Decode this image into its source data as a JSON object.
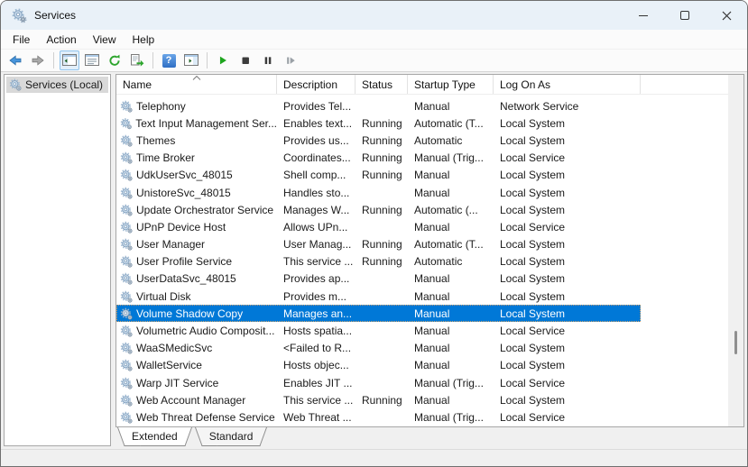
{
  "window": {
    "title": "Services",
    "controls": [
      {
        "name": "minimize",
        "icon": "minimize-icon"
      },
      {
        "name": "maximize",
        "icon": "maximize-icon"
      },
      {
        "name": "close",
        "icon": "close-icon"
      }
    ]
  },
  "menu": {
    "items": [
      "File",
      "Action",
      "View",
      "Help"
    ]
  },
  "toolbar": {
    "icons": [
      "back-arrow-icon",
      "forward-arrow-icon",
      "show-console-tree-icon",
      "properties-icon",
      "refresh-icon",
      "export-list-icon",
      "help-icon",
      "show-action-pane-icon",
      "start-service-icon",
      "stop-service-icon",
      "pause-service-icon",
      "restart-service-icon"
    ]
  },
  "sidebar": {
    "root_label": "Services (Local)"
  },
  "table": {
    "columns": [
      {
        "label": "Name"
      },
      {
        "label": "Description"
      },
      {
        "label": "Status"
      },
      {
        "label": "Startup Type"
      },
      {
        "label": "Log On As"
      }
    ],
    "sort": {
      "column": "Name",
      "direction": "ascending"
    },
    "rows": [
      {
        "name": "Telephony",
        "description": "Provides Tel...",
        "status": "",
        "startup_type": "Manual",
        "log_on_as": "Network Service",
        "selected": false
      },
      {
        "name": "Text Input Management Ser...",
        "description": "Enables text...",
        "status": "Running",
        "startup_type": "Automatic (T...",
        "log_on_as": "Local System",
        "selected": false
      },
      {
        "name": "Themes",
        "description": "Provides us...",
        "status": "Running",
        "startup_type": "Automatic",
        "log_on_as": "Local System",
        "selected": false
      },
      {
        "name": "Time Broker",
        "description": "Coordinates...",
        "status": "Running",
        "startup_type": "Manual (Trig...",
        "log_on_as": "Local Service",
        "selected": false
      },
      {
        "name": "UdkUserSvc_48015",
        "description": "Shell comp...",
        "status": "Running",
        "startup_type": "Manual",
        "log_on_as": "Local System",
        "selected": false
      },
      {
        "name": "UnistoreSvc_48015",
        "description": "Handles sto...",
        "status": "",
        "startup_type": "Manual",
        "log_on_as": "Local System",
        "selected": false
      },
      {
        "name": "Update Orchestrator Service",
        "description": "Manages W...",
        "status": "Running",
        "startup_type": "Automatic (...",
        "log_on_as": "Local System",
        "selected": false
      },
      {
        "name": "UPnP Device Host",
        "description": "Allows UPn...",
        "status": "",
        "startup_type": "Manual",
        "log_on_as": "Local Service",
        "selected": false
      },
      {
        "name": "User Manager",
        "description": "User Manag...",
        "status": "Running",
        "startup_type": "Automatic (T...",
        "log_on_as": "Local System",
        "selected": false
      },
      {
        "name": "User Profile Service",
        "description": "This service ...",
        "status": "Running",
        "startup_type": "Automatic",
        "log_on_as": "Local System",
        "selected": false
      },
      {
        "name": "UserDataSvc_48015",
        "description": "Provides ap...",
        "status": "",
        "startup_type": "Manual",
        "log_on_as": "Local System",
        "selected": false
      },
      {
        "name": "Virtual Disk",
        "description": "Provides m...",
        "status": "",
        "startup_type": "Manual",
        "log_on_as": "Local System",
        "selected": false
      },
      {
        "name": "Volume Shadow Copy",
        "description": "Manages an...",
        "status": "",
        "startup_type": "Manual",
        "log_on_as": "Local System",
        "selected": true
      },
      {
        "name": "Volumetric Audio Composit...",
        "description": "Hosts spatia...",
        "status": "",
        "startup_type": "Manual",
        "log_on_as": "Local Service",
        "selected": false
      },
      {
        "name": "WaaSMedicSvc",
        "description": "<Failed to R...",
        "status": "",
        "startup_type": "Manual",
        "log_on_as": "Local System",
        "selected": false
      },
      {
        "name": "WalletService",
        "description": "Hosts objec...",
        "status": "",
        "startup_type": "Manual",
        "log_on_as": "Local System",
        "selected": false
      },
      {
        "name": "Warp JIT Service",
        "description": "Enables JIT ...",
        "status": "",
        "startup_type": "Manual (Trig...",
        "log_on_as": "Local Service",
        "selected": false
      },
      {
        "name": "Web Account Manager",
        "description": "This service ...",
        "status": "Running",
        "startup_type": "Manual",
        "log_on_as": "Local System",
        "selected": false
      },
      {
        "name": "Web Threat Defense Service",
        "description": "Web Threat ...",
        "status": "",
        "startup_type": "Manual (Trig...",
        "log_on_as": "Local Service",
        "selected": false
      }
    ]
  },
  "tabs": {
    "items": [
      {
        "label": "Extended",
        "active": true
      },
      {
        "label": "Standard",
        "active": false
      }
    ]
  },
  "colors": {
    "selection": "#0078d7",
    "titlebar": "#e9f1f8",
    "accent_green": "#1ea51e",
    "toolbar_active_border": "#90c3ec"
  }
}
